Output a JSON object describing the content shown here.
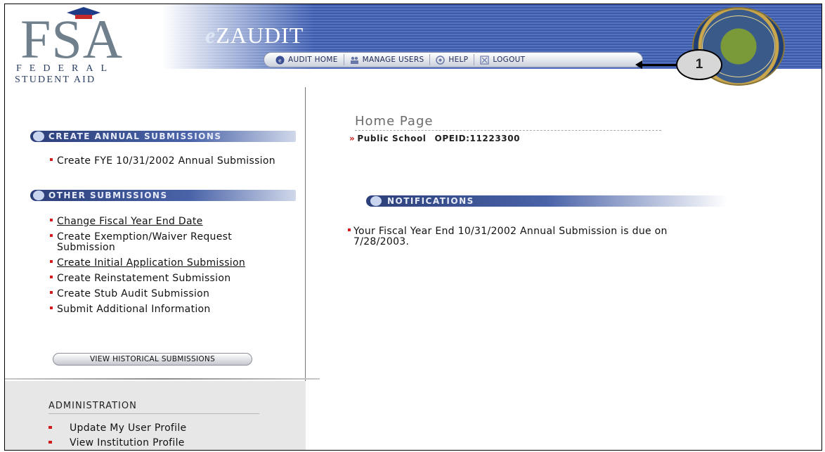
{
  "header": {
    "logo_main": "FSA",
    "logo_line1": "FEDERAL",
    "logo_line2": "STUDENT AID",
    "app_title_prefix": "e",
    "app_title_main": "ZAUDIT",
    "seal_icon": "department-of-education-seal-icon",
    "nav": [
      {
        "label": "AUDIT HOME",
        "icon": "ez-icon"
      },
      {
        "label": "MANAGE USERS",
        "icon": "users-icon"
      },
      {
        "label": "HELP",
        "icon": "help-icon"
      },
      {
        "label": "LOGOUT",
        "icon": "logout-icon"
      }
    ]
  },
  "callout": {
    "number": "1"
  },
  "sidebar": {
    "create_annual": {
      "header": "CREATE ANNUAL SUBMISSIONS",
      "items": [
        "Create FYE 10/31/2002 Annual Submission"
      ]
    },
    "other": {
      "header": "OTHER SUBMISSIONS",
      "items": [
        {
          "label": "Change Fiscal Year End Date",
          "link": true
        },
        {
          "label": "Create Exemption/Waiver Request Submission",
          "link": false
        },
        {
          "label": "Create Initial Application Submission",
          "link": true
        },
        {
          "label": "Create Reinstatement Submission",
          "link": false
        },
        {
          "label": "Create Stub Audit Submission",
          "link": false
        },
        {
          "label": "Submit Additional Information",
          "link": false
        }
      ]
    },
    "view_historical_label": "VIEW HISTORICAL SUBMISSIONS",
    "administration": {
      "title": "ADMINISTRATION",
      "items": [
        "Update My User Profile",
        "View Institution Profile"
      ]
    }
  },
  "main": {
    "page_title": "Home Page",
    "institution_name": "Public School",
    "opeid": "OPEID:11223300",
    "notifications": {
      "header": "NOTIFICATIONS",
      "items": [
        "Your Fiscal Year End 10/31/2002 Annual Submission is due on 7/28/2003."
      ]
    }
  },
  "colors": {
    "banner_blue": "#3c5aa8",
    "header_navy": "#2c3f7a",
    "bullet_red": "#d21b1b",
    "sidebar_admin_bg": "#e7e7e7"
  }
}
